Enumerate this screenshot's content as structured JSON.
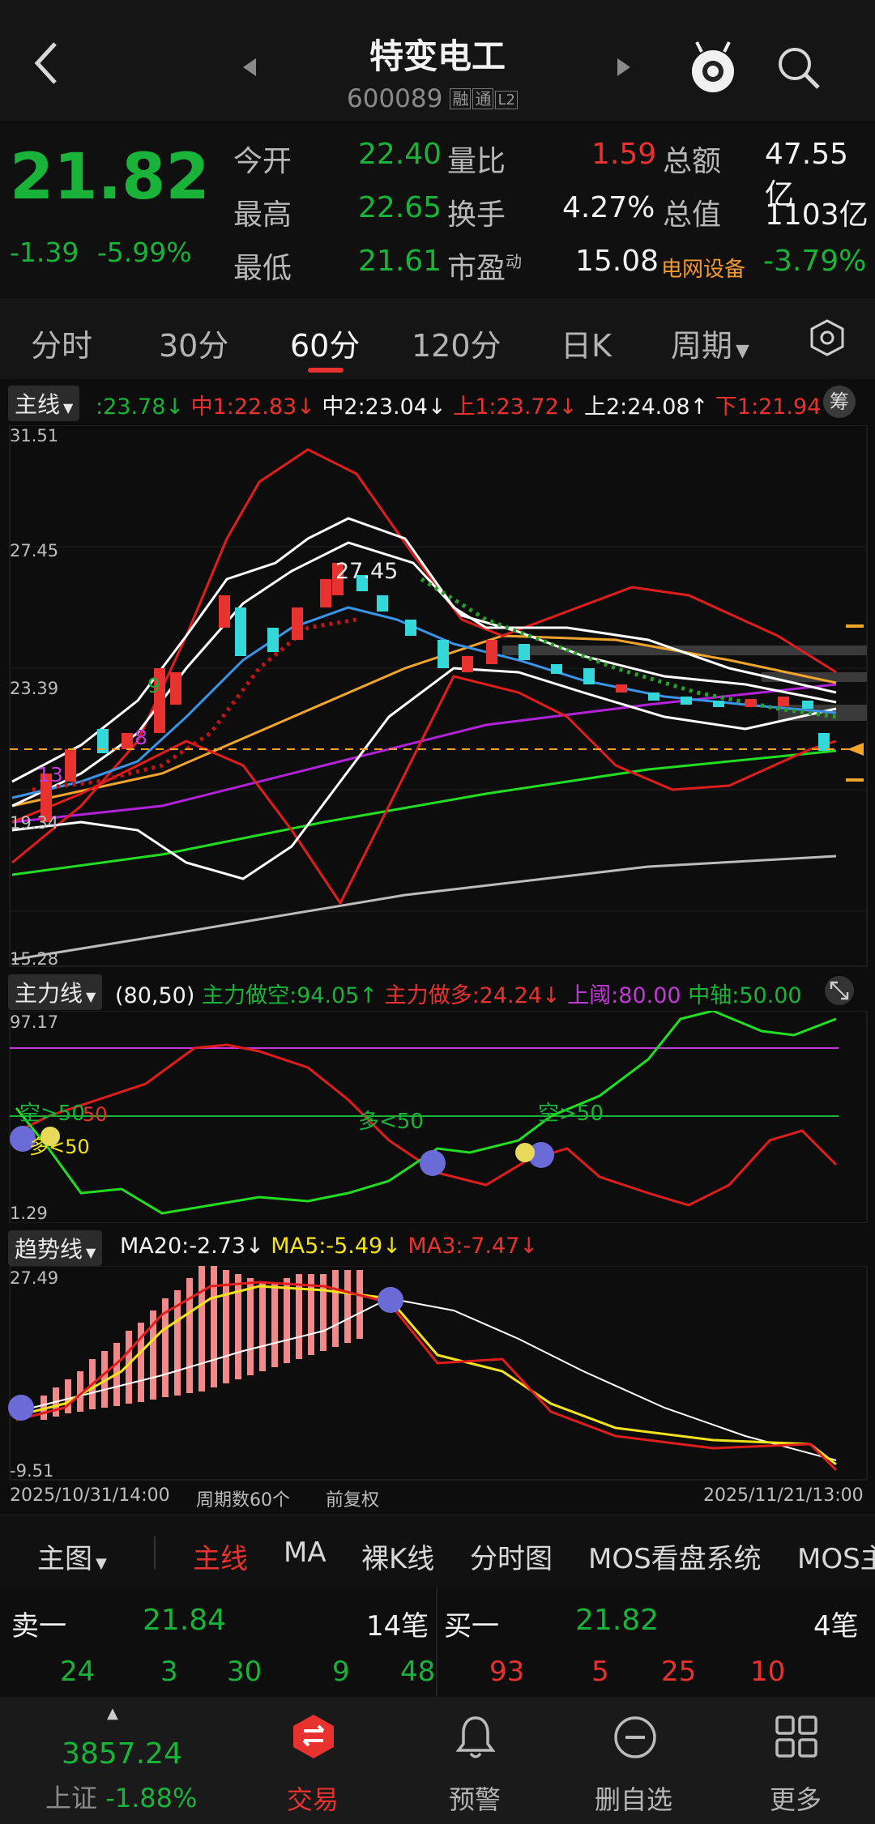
{
  "header": {
    "title": "特变电工",
    "code": "600089",
    "badges": [
      "融",
      "通",
      "L2"
    ]
  },
  "quote": {
    "price": "21.82",
    "change": "-1.39",
    "change_pct": "-5.99%",
    "open_label": "今开",
    "open_value": "22.40",
    "high_label": "最高",
    "high_value": "22.65",
    "low_label": "最低",
    "low_value": "21.61",
    "vol_ratio_label": "量比",
    "vol_ratio_value": "1.59",
    "turnover_label": "换手",
    "turnover_value": "4.27%",
    "pe_label": "市盈",
    "pe_sup": "动",
    "pe_value": "15.08",
    "amount_label": "总额",
    "amount_value": "47.55亿",
    "mktcap_label": "总值",
    "mktcap_value": "1103亿",
    "sector_label": "电网设备",
    "sector_value": "-3.79%"
  },
  "tabs": [
    "分时",
    "30分",
    "60分",
    "120分",
    "日K",
    "周期"
  ],
  "active_tab": "60分",
  "main_chart": {
    "selector": "主线",
    "legend": {
      "v0": ":23.78↓",
      "mid1": "中1:22.83↓",
      "mid2": "中2:23.04↓",
      "up1": "上1:23.72↓",
      "up2": "上2:24.08↑",
      "down1": "下1:21.94↓"
    },
    "chip_button": "筹",
    "y_ticks": [
      "31.51",
      "27.45",
      "23.39",
      "19.34",
      "15.28"
    ],
    "annotations": {
      "peak": "27.45",
      "n9": "9",
      "n8": "8",
      "n13": "13"
    }
  },
  "indicator1": {
    "selector": "主力线",
    "params": "(80,50)",
    "short_label": "主力做空:94.05↑",
    "long_label": "主力做多:24.24↓",
    "upper_label": "上阈:80.00",
    "axis_label": "中轴:50.00",
    "y_ticks": [
      "97.17",
      "1.29"
    ],
    "signals": [
      "空>50",
      "多<50",
      "空>50",
      "50",
      "多<50"
    ]
  },
  "indicator2": {
    "selector": "趋势线",
    "ma20": "MA20:-2.73↓",
    "ma5": "MA5:-5.49↓",
    "ma3": "MA3:-7.47↓",
    "y_ticks": [
      "27.49",
      "-9.51"
    ]
  },
  "time_axis": {
    "start": "2025/10/31/14:00",
    "periods": "周期数60个",
    "adjust": "前复权",
    "end": "2025/11/21/13:00"
  },
  "tools": {
    "main_chart": "主图",
    "items": [
      "主线",
      "MA",
      "裸K线",
      "分时图",
      "MOS看盘系统",
      "MOS主"
    ]
  },
  "orderbook": {
    "sell1_label": "卖一",
    "sell1_price": "21.84",
    "sell1_count": "14笔",
    "buy1_label": "买一",
    "buy1_price": "21.82",
    "buy1_count": "4笔",
    "sell_vols": [
      "24",
      "3",
      "30",
      "9",
      "48"
    ],
    "buy_vols": [
      "93",
      "5",
      "25",
      "10"
    ]
  },
  "nav": {
    "index_value": "3857.24",
    "index_name": "上证",
    "index_change": "-1.88%",
    "trade": "交易",
    "alert": "预警",
    "remove": "删自选",
    "more": "更多"
  },
  "colors": {
    "up": "#e8322f",
    "down": "#19b33a",
    "bg": "#0d0d0d"
  }
}
